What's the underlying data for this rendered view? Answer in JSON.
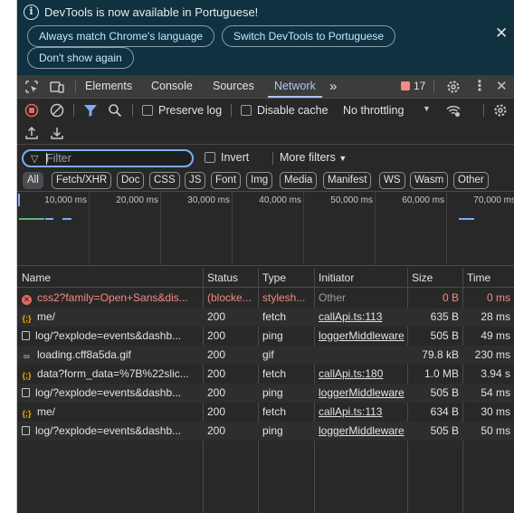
{
  "infobar": {
    "message": "DevTools is now available in Portuguese!",
    "buttons": [
      "Always match Chrome's language",
      "Switch DevTools to Portuguese",
      "Don't show again"
    ]
  },
  "tabs": {
    "items": [
      "Elements",
      "Console",
      "Sources",
      "Network"
    ],
    "active": "Network",
    "issues_count": "17"
  },
  "toolbar": {
    "preserve_log": "Preserve log",
    "disable_cache": "Disable cache",
    "throttling": "No throttling"
  },
  "filter": {
    "placeholder": "Filter",
    "invert": "Invert",
    "more_filters": "More filters"
  },
  "types": [
    "All",
    "Fetch/XHR",
    "Doc",
    "CSS",
    "JS",
    "Font",
    "Img",
    "Media",
    "Manifest",
    "WS",
    "Wasm",
    "Other"
  ],
  "overview": {
    "ticks": [
      "10,000 ms",
      "20,000 ms",
      "30,000 ms",
      "40,000 ms",
      "50,000 ms",
      "60,000 ms",
      "70,000 ms"
    ]
  },
  "table": {
    "columns": [
      "Name",
      "Status",
      "Type",
      "Initiator",
      "Size",
      "Time"
    ],
    "rows": [
      {
        "icon": "error-icon",
        "name": "css2?family=Open+Sans&dis...",
        "status": "(blocke...",
        "type": "stylesh...",
        "initiator": "Other",
        "size": "0 B",
        "time": "0 ms"
      },
      {
        "icon": "fetch-icon",
        "name": "me/",
        "status": "200",
        "type": "fetch",
        "initiator": "callApi.ts:113",
        "size": "635 B",
        "time": "28 ms"
      },
      {
        "icon": "document-icon",
        "name": "log/?explode=events&dashb...",
        "status": "200",
        "type": "ping",
        "initiator": "loggerMiddleware",
        "size": "505 B",
        "time": "49 ms"
      },
      {
        "icon": "gif-icon",
        "name": "loading.cff8a5da.gif",
        "status": "200",
        "type": "gif",
        "initiator": "",
        "size": "79.8 kB",
        "time": "230 ms"
      },
      {
        "icon": "fetch-icon",
        "name": "data?form_data=%7B%22slic...",
        "status": "200",
        "type": "fetch",
        "initiator": "callApi.ts:180",
        "size": "1.0 MB",
        "time": "3.94 s"
      },
      {
        "icon": "document-icon",
        "name": "log/?explode=events&dashb...",
        "status": "200",
        "type": "ping",
        "initiator": "loggerMiddleware",
        "size": "505 B",
        "time": "54 ms"
      },
      {
        "icon": "fetch-icon",
        "name": "me/",
        "status": "200",
        "type": "fetch",
        "initiator": "callApi.ts:113",
        "size": "634 B",
        "time": "30 ms"
      },
      {
        "icon": "document-icon",
        "name": "log/?explode=events&dashb...",
        "status": "200",
        "type": "ping",
        "initiator": "loggerMiddleware",
        "size": "505 B",
        "time": "50 ms"
      }
    ]
  }
}
